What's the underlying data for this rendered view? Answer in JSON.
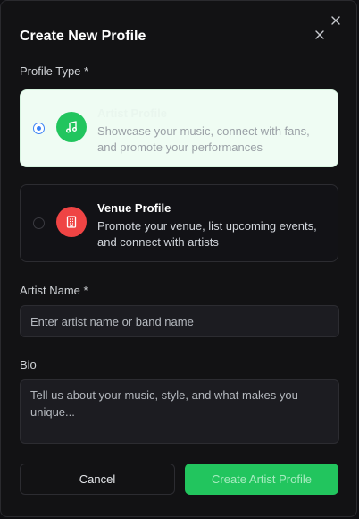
{
  "modal": {
    "title": "Create New Profile"
  },
  "profile_type": {
    "label": "Profile Type *",
    "options": [
      {
        "title": "Artist Profile",
        "description": "Showcase your music, connect with fans, and promote your performances",
        "icon": "music-note-icon",
        "icon_color": "#22c55e",
        "selected": true
      },
      {
        "title": "Venue Profile",
        "description": "Promote your venue, list upcoming events, and connect with artists",
        "icon": "building-icon",
        "icon_color": "#ef4444",
        "selected": false
      }
    ]
  },
  "artist_name": {
    "label": "Artist Name *",
    "placeholder": "Enter artist name or band name",
    "value": ""
  },
  "bio": {
    "label": "Bio",
    "placeholder": "Tell us about your music, style, and what makes you unique...",
    "value": ""
  },
  "actions": {
    "cancel_label": "Cancel",
    "submit_label": "Create Artist Profile"
  },
  "colors": {
    "accent": "#22c55e",
    "radio_accent": "#3b82f6",
    "background": "#121214"
  }
}
